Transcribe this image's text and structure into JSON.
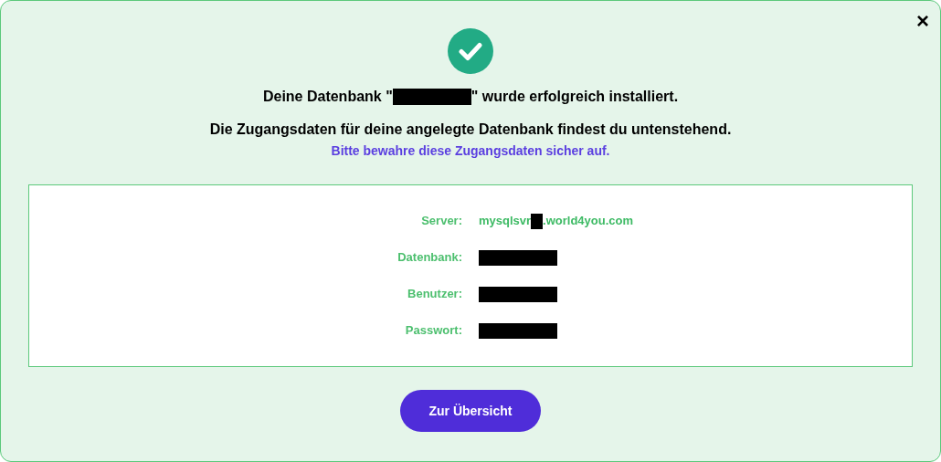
{
  "dialog": {
    "close": "×",
    "heading": [
      {
        "kind": "text",
        "text": "Deine Datenbank \""
      },
      {
        "kind": "redacted"
      },
      {
        "kind": "text",
        "text": "\" wurde erfolgreich installiert."
      }
    ],
    "subheading": "Die Zugangsdaten für deine angelegte Datenbank findest du untenstehend.",
    "notice": "Bitte bewahre diese Zugangsdaten sicher auf.",
    "credentials": [
      {
        "label": "Server:",
        "value": [
          {
            "kind": "text",
            "text": "mysqlsvr"
          },
          {
            "kind": "redacted"
          },
          {
            "kind": "text",
            "text": ".world4you.com"
          }
        ]
      },
      {
        "label": "Datenbank:",
        "value": [
          {
            "kind": "redacted"
          }
        ]
      },
      {
        "label": "Benutzer:",
        "value": [
          {
            "kind": "redacted"
          }
        ]
      },
      {
        "label": "Passwort:",
        "value": [
          {
            "kind": "redacted"
          }
        ]
      }
    ],
    "button": "Zur Übersicht"
  }
}
